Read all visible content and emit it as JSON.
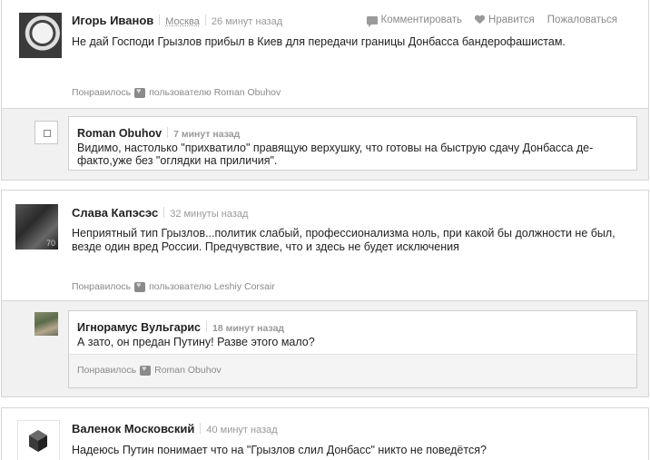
{
  "actions": {
    "comment": "Комментировать",
    "like": "Нравится",
    "report": "Пожаловаться"
  },
  "comments": [
    {
      "author": "Игорь Иванов",
      "location": "Москва",
      "time": "26 минут назад",
      "text": "Не дай Господи Грызлов прибыл в Киев для передачи границы Донбасса бандерофашистам.",
      "liked_prefix": "Понравилось",
      "liked_text": "пользователю Roman Obuhov",
      "reply": {
        "author": "Roman Obuhov",
        "time": "7 минут назад",
        "text": "Видимо, настолько \"прихватило\" правящую верхушку, что готовы на быструю сдачу Донбасса де-факто,уже без \"оглядки на приличия\"."
      }
    },
    {
      "author": "Слава Капэсэс",
      "time": "32 минуты назад",
      "text": "Неприятный тип Грызлов...политик слабый, профессионализма ноль, при какой бы должности не был, везде один вред России. Предчувствие, что и здесь не будет исключения",
      "liked_prefix": "Понравилось",
      "liked_text": "пользователю Leshiy Corsair",
      "reply": {
        "author": "Игнорамус Вульгарис",
        "time": "18 минут назад",
        "text": "А зато, он предан Путину! Разве этого мало?",
        "liked_prefix": "Понравилось",
        "liked_text": "Roman Obuhov"
      }
    },
    {
      "author": "Валенок Московский",
      "time": "40 минут назад",
      "text": "Надеюсь Путин понимает что на \"Грызлов слил Донбасс\" никто не поведётся?"
    }
  ]
}
